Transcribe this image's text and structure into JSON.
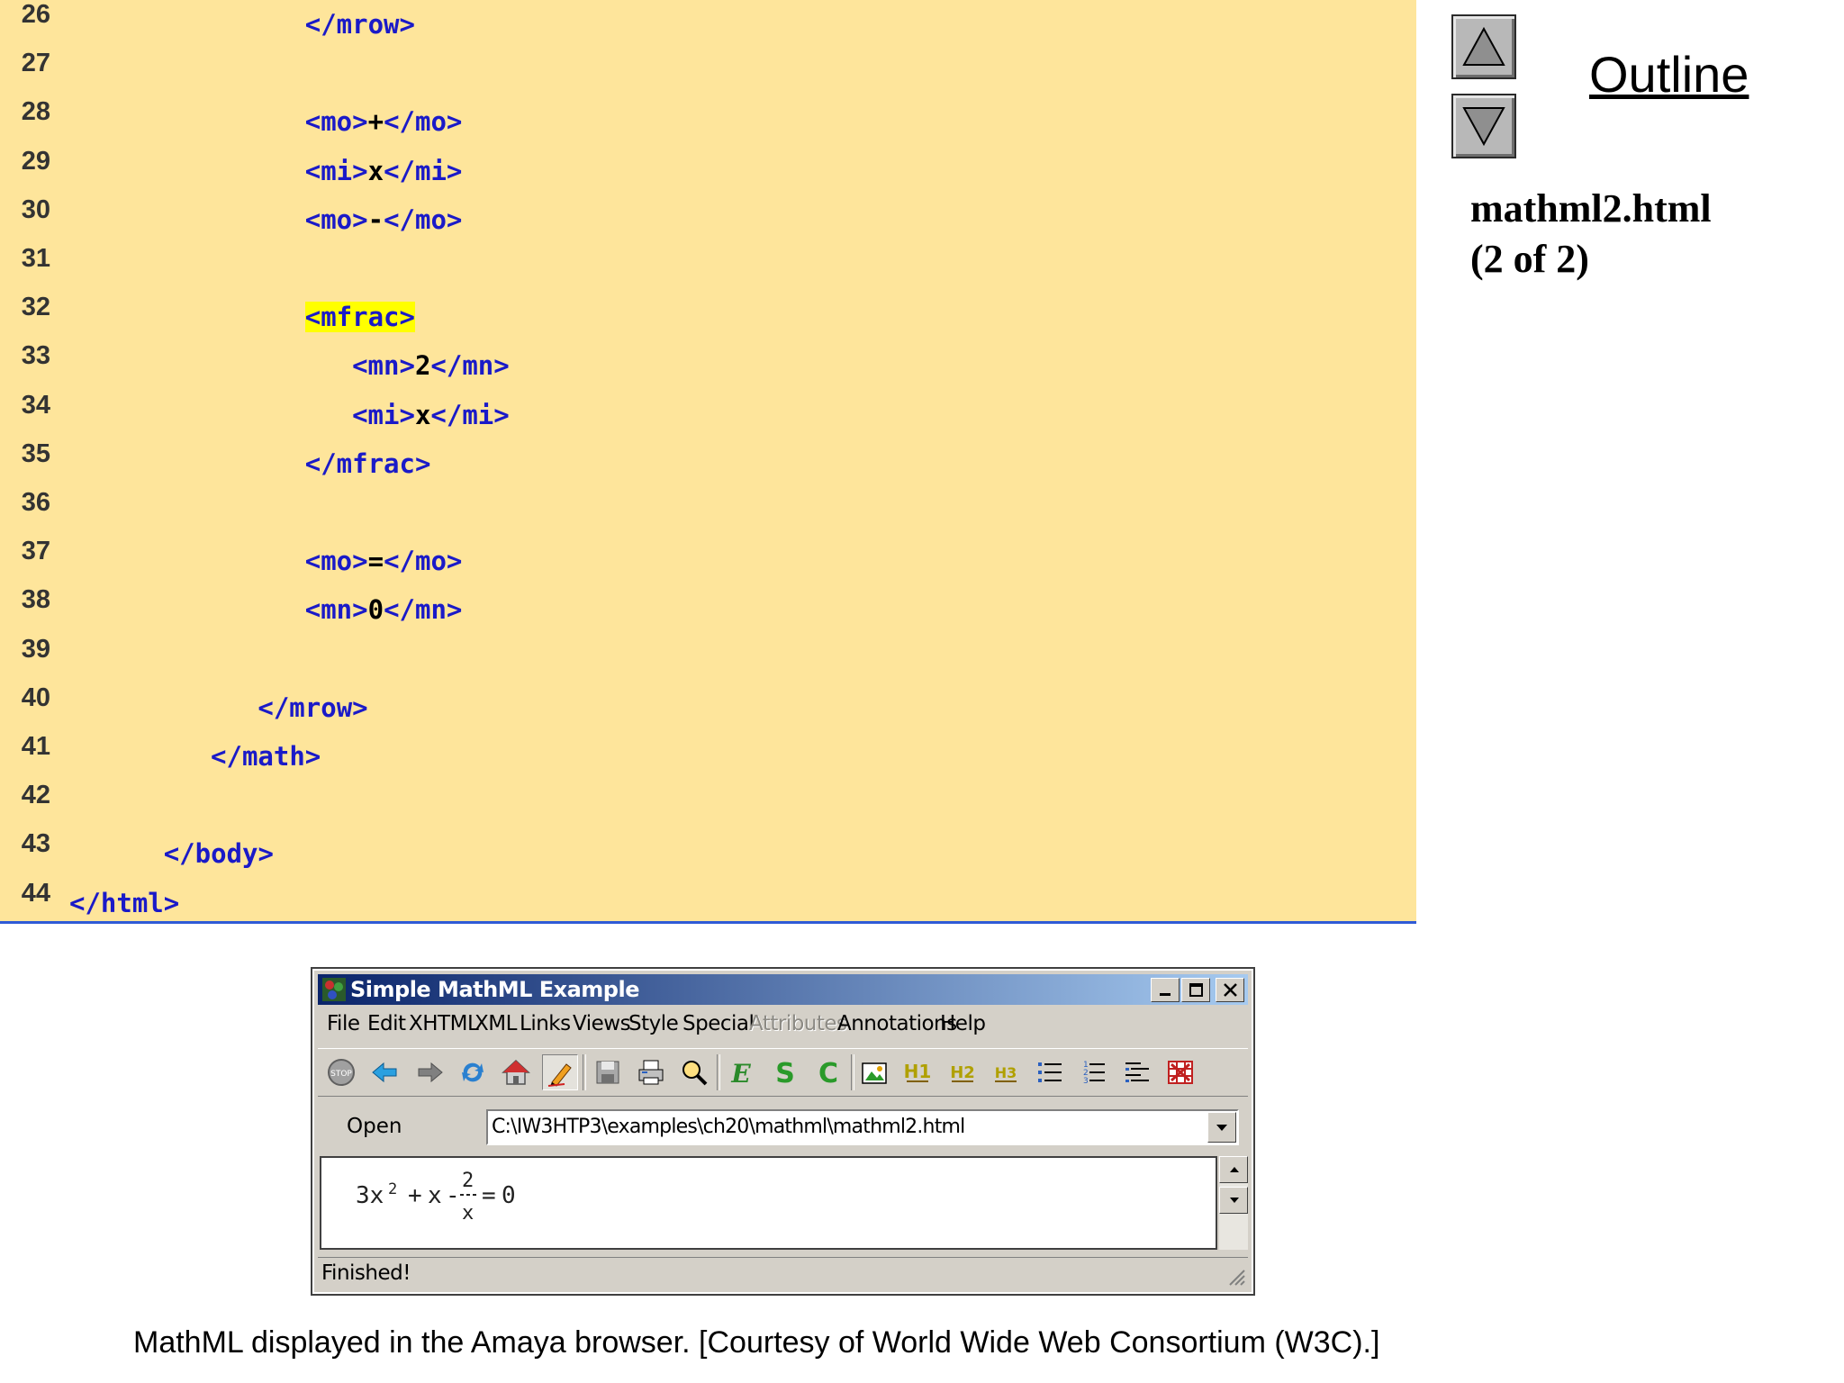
{
  "code_lines": [
    {
      "num": "26",
      "indent": 16,
      "parts": [
        {
          "text": "</mrow>",
          "kind": "tag"
        }
      ]
    },
    {
      "num": "27",
      "indent": 0,
      "parts": []
    },
    {
      "num": "28",
      "indent": 16,
      "parts": [
        {
          "text": "<mo>",
          "kind": "tag"
        },
        {
          "text": "+",
          "kind": "txt"
        },
        {
          "text": "</mo>",
          "kind": "tag"
        }
      ]
    },
    {
      "num": "29",
      "indent": 16,
      "parts": [
        {
          "text": "<mi>",
          "kind": "tag"
        },
        {
          "text": "x",
          "kind": "txt"
        },
        {
          "text": "</mi>",
          "kind": "tag"
        }
      ]
    },
    {
      "num": "30",
      "indent": 16,
      "parts": [
        {
          "text": "<mo>",
          "kind": "tag"
        },
        {
          "text": "-",
          "kind": "txt"
        },
        {
          "text": "</mo>",
          "kind": "tag"
        }
      ]
    },
    {
      "num": "31",
      "indent": 0,
      "parts": []
    },
    {
      "num": "32",
      "indent": 16,
      "parts": [
        {
          "text": "<mfrac>",
          "kind": "hl"
        }
      ]
    },
    {
      "num": "33",
      "indent": 19,
      "parts": [
        {
          "text": "<mn>",
          "kind": "tag"
        },
        {
          "text": "2",
          "kind": "txt"
        },
        {
          "text": "</mn>",
          "kind": "tag"
        }
      ]
    },
    {
      "num": "34",
      "indent": 19,
      "parts": [
        {
          "text": "<mi>",
          "kind": "tag"
        },
        {
          "text": "x",
          "kind": "txt"
        },
        {
          "text": "</mi>",
          "kind": "tag"
        }
      ]
    },
    {
      "num": "35",
      "indent": 16,
      "parts": [
        {
          "text": "</mfrac>",
          "kind": "tag"
        }
      ]
    },
    {
      "num": "36",
      "indent": 0,
      "parts": []
    },
    {
      "num": "37",
      "indent": 16,
      "parts": [
        {
          "text": "<mo>",
          "kind": "tag"
        },
        {
          "text": "=",
          "kind": "txt"
        },
        {
          "text": "</mo>",
          "kind": "tag"
        }
      ]
    },
    {
      "num": "38",
      "indent": 16,
      "parts": [
        {
          "text": "<mn>",
          "kind": "tag"
        },
        {
          "text": "0",
          "kind": "txt"
        },
        {
          "text": "</mn>",
          "kind": "tag"
        }
      ]
    },
    {
      "num": "39",
      "indent": 0,
      "parts": []
    },
    {
      "num": "40",
      "indent": 13,
      "parts": [
        {
          "text": "</mrow>",
          "kind": "tag"
        }
      ]
    },
    {
      "num": "41",
      "indent": 10,
      "parts": [
        {
          "text": "</math>",
          "kind": "tag"
        }
      ]
    },
    {
      "num": "42",
      "indent": 0,
      "parts": []
    },
    {
      "num": "43",
      "indent": 7,
      "parts": [
        {
          "text": "</body>",
          "kind": "tag"
        }
      ]
    },
    {
      "num": "44",
      "indent": 1,
      "parts": [
        {
          "text": "</html>",
          "kind": "tag"
        }
      ]
    }
  ],
  "outline": {
    "link_text": "Outline",
    "file_name": "mathml2.html",
    "page_info": "(2 of 2)",
    "up_icon": "triangle-up-icon",
    "down_icon": "triangle-down-icon"
  },
  "window": {
    "title": "Simple MathML Example",
    "menu": [
      {
        "label": "File",
        "disabled": false
      },
      {
        "label": "Edit",
        "disabled": false
      },
      {
        "label": "XHTML",
        "disabled": false
      },
      {
        "label": "XML",
        "disabled": false
      },
      {
        "label": "Links",
        "disabled": false
      },
      {
        "label": "Views",
        "disabled": false
      },
      {
        "label": "Style",
        "disabled": false
      },
      {
        "label": "Special",
        "disabled": false
      },
      {
        "label": "Attributes",
        "disabled": true
      },
      {
        "label": "Annotations",
        "disabled": false
      },
      {
        "label": "Help",
        "disabled": false
      }
    ],
    "toolbar": [
      "stop-icon",
      "back-icon",
      "forward-icon",
      "reload-icon",
      "home-icon",
      "edit-pen-icon",
      "save-icon",
      "print-icon",
      "find-icon",
      "emphasis-icon",
      "strong-icon",
      "code-icon",
      "image-icon",
      "heading1-icon",
      "heading2-icon",
      "heading3-icon",
      "bullet-list-icon",
      "numbered-list-icon",
      "definition-list-icon",
      "table-icon"
    ],
    "open_label": "Open",
    "url": "C:\\IW3HTP3\\examples\\ch20\\mathml\\mathml2.html",
    "math": {
      "lhs_coef": "3x",
      "exponent": "2",
      "plus": "+",
      "x": "x",
      "minus": "-",
      "numerator": "2",
      "denominator": "x",
      "equals": "=",
      "rhs": "0"
    },
    "status": "Finished!"
  },
  "caption": "MathML displayed in the Amaya browser. [Courtesy of World Wide Web Consortium (W3C).]",
  "colors": {
    "code_bg": "#fee59b",
    "tag": "#1a1ac8",
    "highlight": "#ffff00",
    "title_start": "#0a246a",
    "title_end": "#a6caf0"
  }
}
